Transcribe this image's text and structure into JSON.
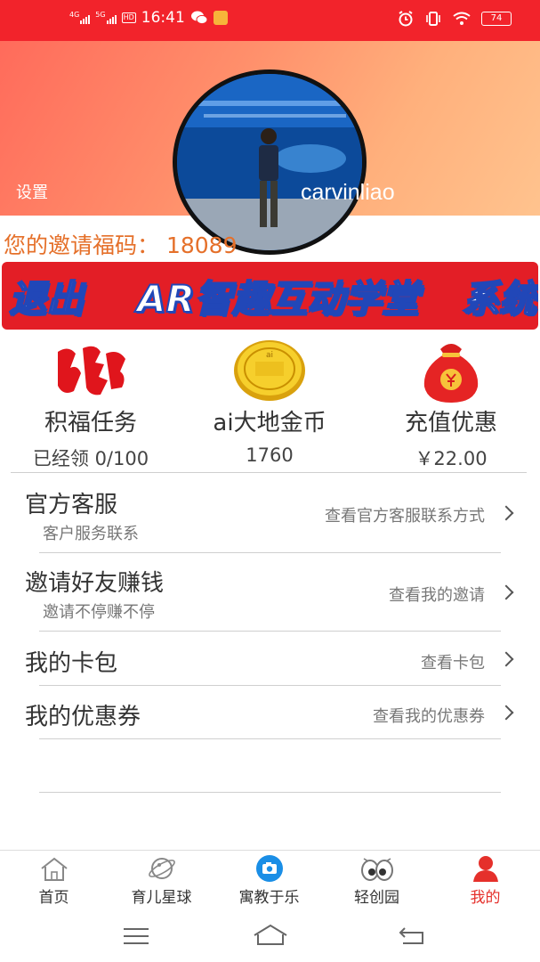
{
  "status_bar": {
    "network1": "4G",
    "network2": "5G",
    "hd": "HD",
    "time": "16:41",
    "battery": "74",
    "icons": [
      "wechat-icon",
      "app-notification-icon",
      "alarm-icon",
      "vibrate-icon",
      "wifi-icon"
    ]
  },
  "profile": {
    "username": "carvinliao",
    "settings_label": "设置"
  },
  "invite": {
    "text": "您的邀请福码：  18089"
  },
  "ar_bar": {
    "logout": "退出",
    "title": "AR智趣互动学堂",
    "system": "系统"
  },
  "features": [
    {
      "icon": "fortune-icon",
      "title": "积福任务",
      "value": "已经领 0/100"
    },
    {
      "icon": "gold-coin-icon",
      "title": "ai大地金币",
      "value": "1760"
    },
    {
      "icon": "money-bag-icon",
      "title": "充值优惠",
      "value": "￥22.00"
    }
  ],
  "menu": [
    {
      "label": "官方客服",
      "sub": "客户服务联系",
      "action": "查看官方客服联系方式"
    },
    {
      "label": "邀请好友赚钱",
      "sub": "邀请不停赚不停",
      "action": "查看我的邀请"
    },
    {
      "label": "我的卡包",
      "sub": "",
      "action": "查看卡包"
    },
    {
      "label": "我的优惠券",
      "sub": "",
      "action": "查看我的优惠券"
    }
  ],
  "nav": [
    {
      "label": "首页",
      "icon": "home-icon"
    },
    {
      "label": "育儿星球",
      "icon": "planet-icon"
    },
    {
      "label": "寓教于乐",
      "icon": "camera-icon"
    },
    {
      "label": "轻创园",
      "icon": "eyes-icon"
    },
    {
      "label": "我的",
      "icon": "user-icon",
      "active": true
    }
  ],
  "colors": {
    "status_bar": "#f2232b",
    "accent_red": "#e31e26",
    "invite_orange": "#e5702a",
    "ar_text_outline": "#2147b8",
    "active_nav": "#e5302b"
  }
}
